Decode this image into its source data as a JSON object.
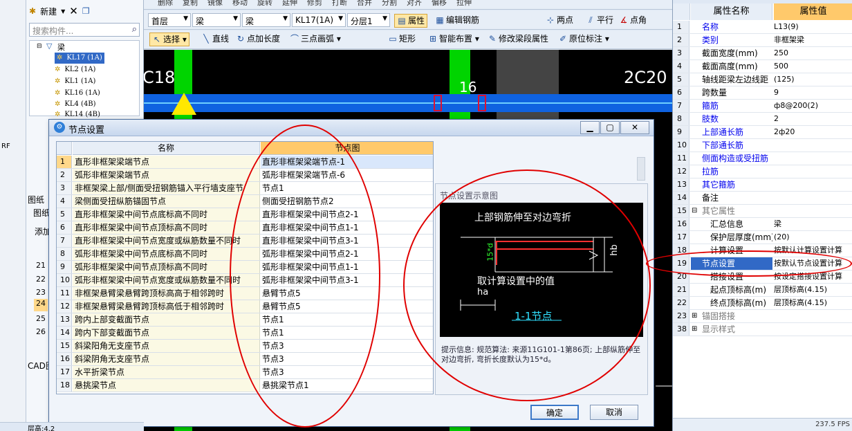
{
  "left": {
    "new_label": "新建",
    "search_placeholder": "搜索构件...",
    "tree_root": "梁",
    "tree_items": [
      "KL17 (1A)",
      "KL2 (1A)",
      "KL1 (1A)",
      "KL16 (1A)",
      "KL4 (4B)",
      "KL14 (4B)"
    ],
    "side_fragments": [
      "RF",
      "图纸",
      "图纸",
      "添加",
      "CAD图"
    ],
    "left_rows": [
      "21",
      "22",
      "23",
      "24",
      "25",
      "26"
    ]
  },
  "toolbar1": [
    "删除",
    "复制",
    "镜像",
    "移动",
    "旋转",
    "延伸",
    "修剪",
    "打断",
    "合并",
    "分割",
    "对齐",
    "偏移",
    "拉伸"
  ],
  "toolbar2": {
    "floor": "首层",
    "type1": "梁",
    "type2": "梁",
    "element": "KL17(1A)",
    "layer": "分层1",
    "attr_btn": "属性",
    "edit_rebar_btn": "编辑钢筋",
    "two_point": "两点",
    "parallel": "平行",
    "point_angle": "点角"
  },
  "toolbar3": {
    "select": "选择",
    "line": "直线",
    "point_length": "点加长度",
    "three_arc": "三点画弧",
    "rect": "矩形",
    "smart": "智能布置",
    "modify_seg": "修改梁段属性",
    "in_situ": "原位标注"
  },
  "canvas": {
    "label_left": "C18",
    "label_right": "2C20",
    "label_mid": "16"
  },
  "props": {
    "col_name": "属性名称",
    "col_value": "属性值",
    "rows": [
      {
        "n": "1",
        "name": "名称",
        "val": "L13(9)",
        "style": "blue"
      },
      {
        "n": "2",
        "name": "类别",
        "val": "非框架梁",
        "style": "blue"
      },
      {
        "n": "3",
        "name": "截面宽度(mm)",
        "val": "250",
        "style": ""
      },
      {
        "n": "4",
        "name": "截面高度(mm)",
        "val": "500",
        "style": ""
      },
      {
        "n": "5",
        "name": "轴线距梁左边线距",
        "val": "(125)",
        "style": ""
      },
      {
        "n": "6",
        "name": "跨数量",
        "val": "9",
        "style": ""
      },
      {
        "n": "7",
        "name": "箍筋",
        "val": "ф8@200(2)",
        "style": "blue"
      },
      {
        "n": "8",
        "name": "肢数",
        "val": "2",
        "style": "blue"
      },
      {
        "n": "9",
        "name": "上部通长筋",
        "val": "2ф20",
        "style": "blue"
      },
      {
        "n": "10",
        "name": "下部通长筋",
        "val": "",
        "style": "blue"
      },
      {
        "n": "11",
        "name": "侧面构造或受扭筋",
        "val": "",
        "style": "blue"
      },
      {
        "n": "12",
        "name": "拉筋",
        "val": "",
        "style": "blue"
      },
      {
        "n": "13",
        "name": "其它箍筋",
        "val": "",
        "style": "blue"
      },
      {
        "n": "14",
        "name": "备注",
        "val": "",
        "style": ""
      },
      {
        "n": "15",
        "name": "其它属性",
        "val": "",
        "style": "gray",
        "expand": "minus"
      },
      {
        "n": "16",
        "name": "汇总信息",
        "val": "梁",
        "style": "",
        "indent": true
      },
      {
        "n": "17",
        "name": "保护层厚度(mm)",
        "val": "(20)",
        "style": "",
        "indent": true
      },
      {
        "n": "18",
        "name": "计算设置",
        "val": "按默认计算设置计算",
        "style": "",
        "indent": true
      },
      {
        "n": "19",
        "name": "节点设置",
        "val": "按默认节点设置计算",
        "style": "",
        "sel": true
      },
      {
        "n": "20",
        "name": "搭接设置",
        "val": "按设定搭接设置计算",
        "style": "",
        "indent": true
      },
      {
        "n": "21",
        "name": "起点顶标高(m)",
        "val": "层顶标高(4.15)",
        "style": "",
        "indent": true
      },
      {
        "n": "22",
        "name": "终点顶标高(m)",
        "val": "层顶标高(4.15)",
        "style": "",
        "indent": true
      },
      {
        "n": "23",
        "name": "锚固搭接",
        "val": "",
        "style": "gray",
        "expand": "plus"
      },
      {
        "n": "38",
        "name": "显示样式",
        "val": "",
        "style": "gray",
        "expand": "plus"
      }
    ]
  },
  "dialog": {
    "title": "节点设置",
    "col_name": "名称",
    "col_node": "节点图",
    "rows": [
      {
        "n": "1",
        "name": "直形非框架梁端节点",
        "val": "直形非框架梁端节点-1"
      },
      {
        "n": "2",
        "name": "弧形非框架梁端节点",
        "val": "弧形非框架梁端节点-6"
      },
      {
        "n": "3",
        "name": "非框架梁上部/侧面受扭钢筋锚入平行墙支座节",
        "val": "节点1"
      },
      {
        "n": "4",
        "name": "梁侧面受扭纵筋锚固节点",
        "val": "侧面受扭钢筋节点2"
      },
      {
        "n": "5",
        "name": "直形非框架梁中间节点底标高不同时",
        "val": "直形非框架梁中间节点2-1"
      },
      {
        "n": "6",
        "name": "直形非框架梁中间节点顶标高不同时",
        "val": "直形非框架梁中间节点1-1"
      },
      {
        "n": "7",
        "name": "直形非框架梁中间节点宽度或纵筋数量不同时",
        "val": "直形非框架梁中间节点3-1"
      },
      {
        "n": "8",
        "name": "弧形非框架梁中间节点底标高不同时",
        "val": "弧形非框架梁中间节点2-1"
      },
      {
        "n": "9",
        "name": "弧形非框架梁中间节点顶标高不同时",
        "val": "弧形非框架梁中间节点1-1"
      },
      {
        "n": "10",
        "name": "弧形非框架梁中间节点宽度或纵筋数量不同时",
        "val": "弧形非框架梁中间节点3-1"
      },
      {
        "n": "11",
        "name": "非框架悬臂梁悬臂跨顶标高高于相邻跨时",
        "val": "悬臂节点5"
      },
      {
        "n": "12",
        "name": "非框架悬臂梁悬臂跨顶标高低于相邻跨时",
        "val": "悬臂节点5"
      },
      {
        "n": "13",
        "name": "跨内上部变截面节点",
        "val": "节点1"
      },
      {
        "n": "14",
        "name": "跨内下部变截面节点",
        "val": "节点1"
      },
      {
        "n": "15",
        "name": "斜梁阳角无支座节点",
        "val": "节点3"
      },
      {
        "n": "16",
        "name": "斜梁阴角无支座节点",
        "val": "节点3"
      },
      {
        "n": "17",
        "name": "水平折梁节点",
        "val": "节点3"
      },
      {
        "n": "18",
        "name": "悬挑梁节点",
        "val": "悬挑梁节点1"
      }
    ],
    "preview_label": "节点设置示意图",
    "diagram_top_text": "上部钢筋伸至对边弯折",
    "diagram_mid_text": "取计算设置中的值",
    "diagram_hb": "hb",
    "diagram_ha": "ha",
    "diagram_15d": "15*d",
    "diagram_node": "1-1节点",
    "tip_text": "提示信息: 规范算法: 来源11G101-1第86页; 上部纵筋伸至对边弯折, 弯折长度默认为15*d。",
    "ok": "确定",
    "cancel": "取消"
  },
  "status": {
    "left": "层高:4.2",
    "right": "237.5 FPS"
  }
}
